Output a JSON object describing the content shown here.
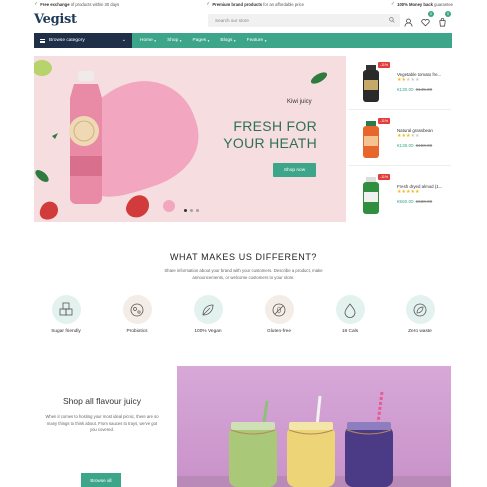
{
  "topbar": {
    "left_bold": "Free exchange",
    "left_text": " of products within 30 days",
    "mid_bold": "Premium brand products",
    "mid_text": " for an affordable price",
    "right_bold": "100% Money back",
    "right_text": " guarantee"
  },
  "header": {
    "logo": "Vegist",
    "search_placeholder": "Search our store",
    "wishlist_count": "0",
    "cart_count": "0"
  },
  "nav": {
    "category": "Browse category",
    "items": [
      {
        "label": "Home"
      },
      {
        "label": "Shop"
      },
      {
        "label": "Pages"
      },
      {
        "label": "Blogs"
      },
      {
        "label": "Feature"
      }
    ]
  },
  "hero": {
    "subtitle": "Kiwi juicy",
    "title_line1": "FRESH FOR",
    "title_line2": "YOUR HEATH",
    "button": "Shop now",
    "slide_count": 3
  },
  "side_products": [
    {
      "sale": "-11%",
      "name": "Vegetable tomato fre...",
      "rating": 2,
      "price": "€130.00",
      "old_price": "€145.00",
      "color": "#2a2a2a",
      "label_color": "#c7a86b"
    },
    {
      "sale": "-11%",
      "name": "Natural grassbean",
      "rating": 3,
      "price": "€135.00",
      "old_price": "€150.00",
      "color": "#e7662b",
      "label_color": "#2a7a4a"
    },
    {
      "sale": "-11%",
      "name": "Fresh dryed almod (1...",
      "rating": 5,
      "price": "€560.00",
      "old_price": "€630.00",
      "color": "#2f8f3f",
      "label_color": "#f0f0f0"
    }
  ],
  "different": {
    "title": "WHAT MAKES US DIFFERENT?",
    "line1": "Share information about your brand with your customers. Describe a product, make",
    "line2": "announcements, or welcome customers to your store.",
    "features": [
      {
        "label": "Sugar friendly",
        "icon": "sugar-cubes-icon",
        "color": "#e3f2ee"
      },
      {
        "label": "Probiotics",
        "icon": "probiotics-icon",
        "color": "#f4ece6"
      },
      {
        "label": "100% Vegan",
        "icon": "leaf-icon",
        "color": "#e3f2ee"
      },
      {
        "label": "Gluten-free",
        "icon": "gluten-free-icon",
        "color": "#f4ece6"
      },
      {
        "label": "18 Cals",
        "icon": "calories-icon",
        "color": "#e3f2ee"
      },
      {
        "label": "Zero waste",
        "icon": "zero-waste-icon",
        "color": "#e3f2ee"
      }
    ]
  },
  "promo": {
    "title": "Shop all flavour juicy",
    "line1": "When it comes to hosting your most ideal picnic, there are so",
    "line2": "many things to think about. From sauces to trays, we've got",
    "line3": "you covered.",
    "button": "Browse all"
  }
}
